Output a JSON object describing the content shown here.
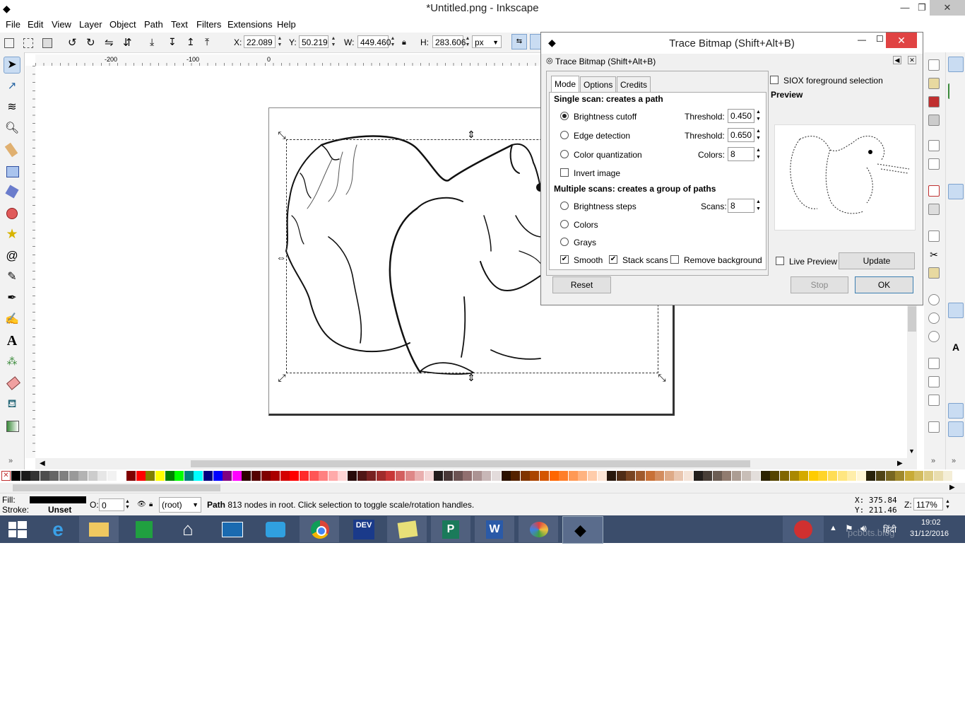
{
  "window": {
    "title": "*Untitled.png - Inkscape",
    "minimize": "—",
    "maximize": "❐",
    "close": "✕"
  },
  "menu": [
    "File",
    "Edit",
    "View",
    "Layer",
    "Object",
    "Path",
    "Text",
    "Filters",
    "Extensions",
    "Help"
  ],
  "controls": {
    "x_label": "X:",
    "x_value": "22.089",
    "y_label": "Y:",
    "y_value": "50.219",
    "w_label": "W:",
    "w_value": "449.460",
    "h_label": "H:",
    "h_value": "283.606",
    "unit": "px"
  },
  "ruler": {
    "ticks": [
      "-200",
      "-100",
      "0"
    ]
  },
  "dialog": {
    "window_title": "Trace Bitmap (Shift+Alt+B)",
    "panel_title": "Trace Bitmap (Shift+Alt+B)",
    "tabs": [
      "Mode",
      "Options",
      "Credits"
    ],
    "single_heading": "Single scan: creates a path",
    "brightness_label": "Brightness cutoff",
    "brightness_threshold_label": "Threshold:",
    "brightness_threshold": "0.450",
    "edge_label": "Edge detection",
    "edge_threshold_label": "Threshold:",
    "edge_threshold": "0.650",
    "colorq_label": "Color quantization",
    "colors_label": "Colors:",
    "colors_value": "8",
    "invert_label": "Invert image",
    "multi_heading": "Multiple scans: creates a group of paths",
    "bsteps_label": "Brightness steps",
    "scans_label": "Scans:",
    "scans_value": "8",
    "mcolors_label": "Colors",
    "grays_label": "Grays",
    "smooth_label": "Smooth",
    "stack_label": "Stack scans",
    "removebg_label": "Remove background",
    "siox_label": "SIOX foreground selection",
    "preview_heading": "Preview",
    "live_label": "Live Preview",
    "update_label": "Update",
    "reset_label": "Reset",
    "stop_label": "Stop",
    "ok_label": "OK"
  },
  "status": {
    "fill_label": "Fill:",
    "stroke_label": "Stroke:",
    "stroke_value": "Unset",
    "opacity_label": "O:",
    "opacity_value": "0",
    "layer": "(root)",
    "message_bold": "Path",
    "message": " 813 nodes in root. Click selection to toggle scale/rotation handles.",
    "x_coord": "X: 375.84",
    "y_coord": "Y: 211.46",
    "zoom_label": "Z:",
    "zoom": "117%"
  },
  "taskbar": {
    "lang": "हिंदी",
    "time": "19:02",
    "date": "31/12/2016",
    "watermark": "pcbots.blog"
  },
  "colors": {
    "accent": "#c9dcf2",
    "close_red": "#e04343",
    "taskbar": "#3b4d6b"
  }
}
